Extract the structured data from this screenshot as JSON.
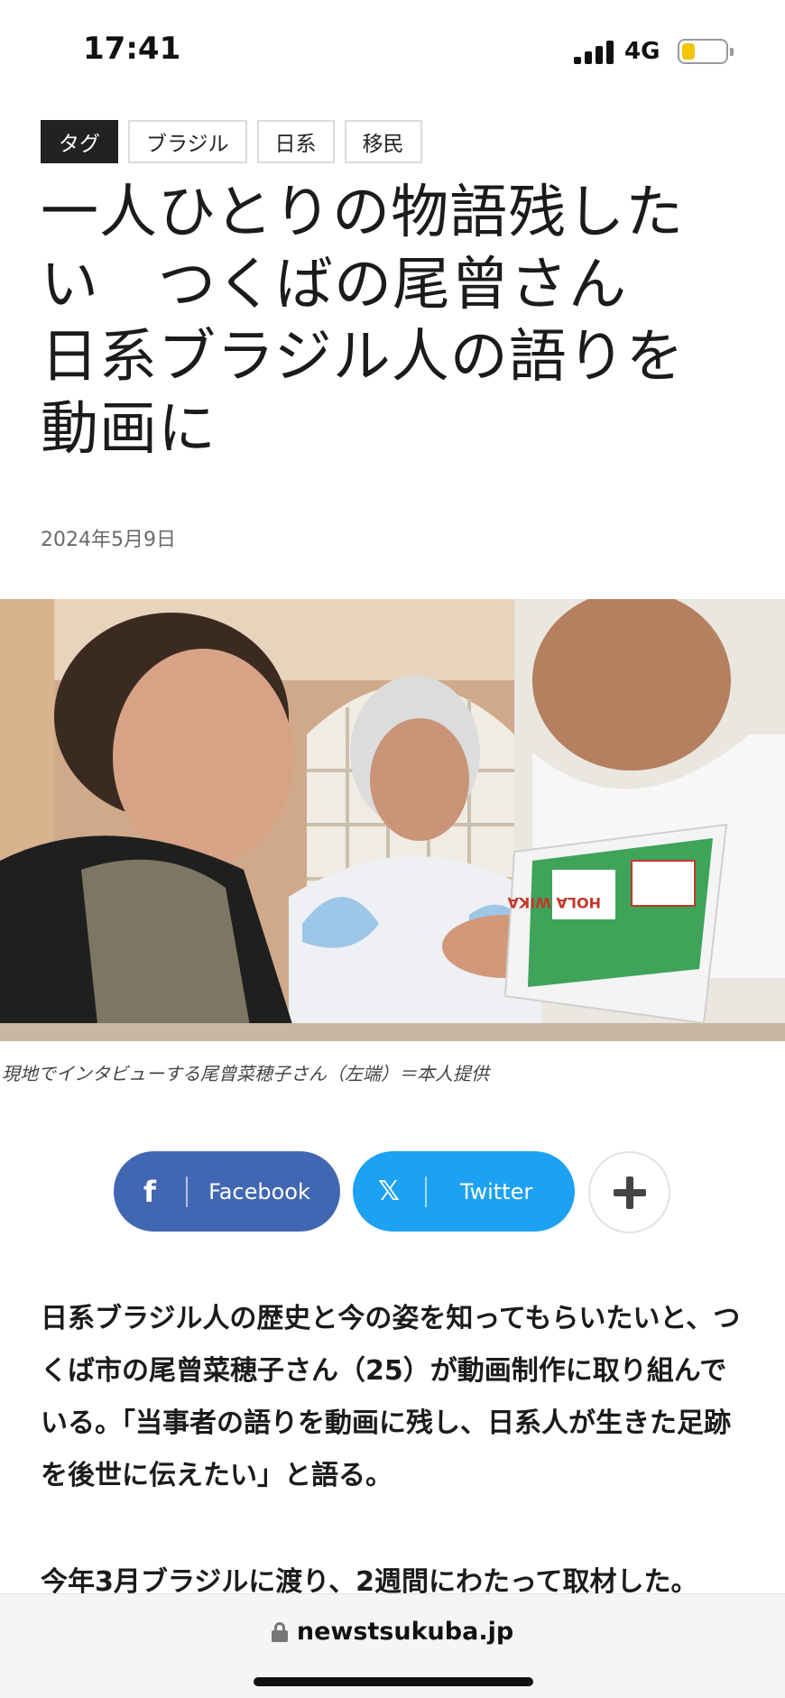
{
  "status_bar": {
    "time": "17:41",
    "network": "4G",
    "battery_level": 0.3
  },
  "tags": {
    "label": "タグ",
    "items": [
      "ブラジル",
      "日系",
      "移民"
    ]
  },
  "article": {
    "headline": "一人ひとりの物語残した\nい　つくばの尾曾さん\n日系ブラジル人の語りを\n動画に",
    "date": "2024年5月9日",
    "photo_caption": "現地でインタビューする尾曾菜穂子さん（左端）＝本人提供",
    "paragraph1": "日系ブラジル人の歴史と今の姿を知ってもらいたいと、つくば市の尾曾菜穂子さん（25）が動画制作に取り組んでいる。「当事者の語りを動画に残し、日系人が生きた足跡を後世に伝えたい」と語る。",
    "paragraph2": "今年3月ブラジルに渡り、2週間にわたって取材した。"
  },
  "share": {
    "facebook_label": "Facebook",
    "twitter_label": "Twitter",
    "facebook_icon": "facebook-f-icon",
    "twitter_icon": "x-logo-icon",
    "more_icon": "plus-icon",
    "facebook_color": "#4267b2",
    "twitter_color": "#1da1f2"
  },
  "browser": {
    "url": "newstsukuba.jp"
  },
  "photo_booklet_text": "HOLA WIKA"
}
